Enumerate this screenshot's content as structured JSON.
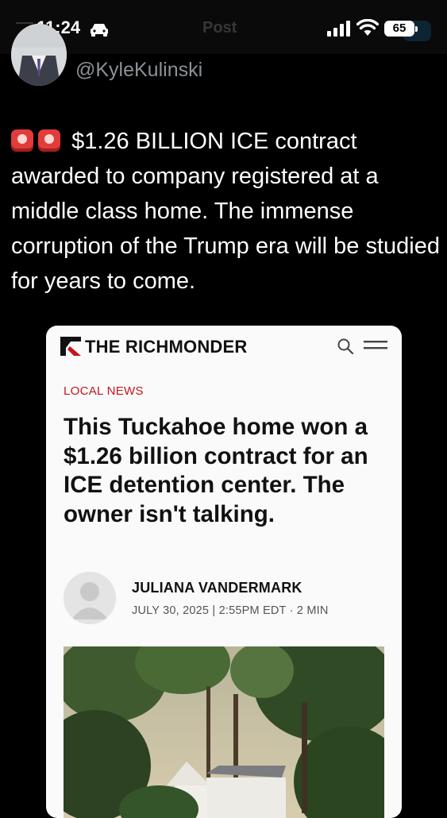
{
  "status_bar": {
    "time": "11:24",
    "battery": "65",
    "icons": [
      "car-icon",
      "signal-icon",
      "wifi-icon",
      "battery-icon"
    ]
  },
  "header": {
    "title_ghost": "Post"
  },
  "tweet": {
    "handle": "@KyleKulinski",
    "emoji": [
      "siren-icon",
      "siren-icon"
    ],
    "text": "$1.26 BILLION ICE contract awarded to company registered at a middle class home. The immense corruption of the Trump era will be studied for years to come."
  },
  "article_card": {
    "publication": "THE RICHMONDER",
    "section": "LOCAL NEWS",
    "headline": "This Tuckahoe home won a $1.26 billion contract for an ICE detention center. The owner isn't talking.",
    "author": "JULIANA VANDERMARK",
    "meta": "JULY 30, 2025 | 2:55PM EDT · 2 MIN",
    "icons": [
      "richmonder-logo-icon",
      "search-icon",
      "menu-icon",
      "author-avatar-icon"
    ]
  },
  "colors": {
    "background": "#000000",
    "handle_gray": "#8b9198",
    "section_red": "#c4161c",
    "card_bg": "#fafafa"
  }
}
